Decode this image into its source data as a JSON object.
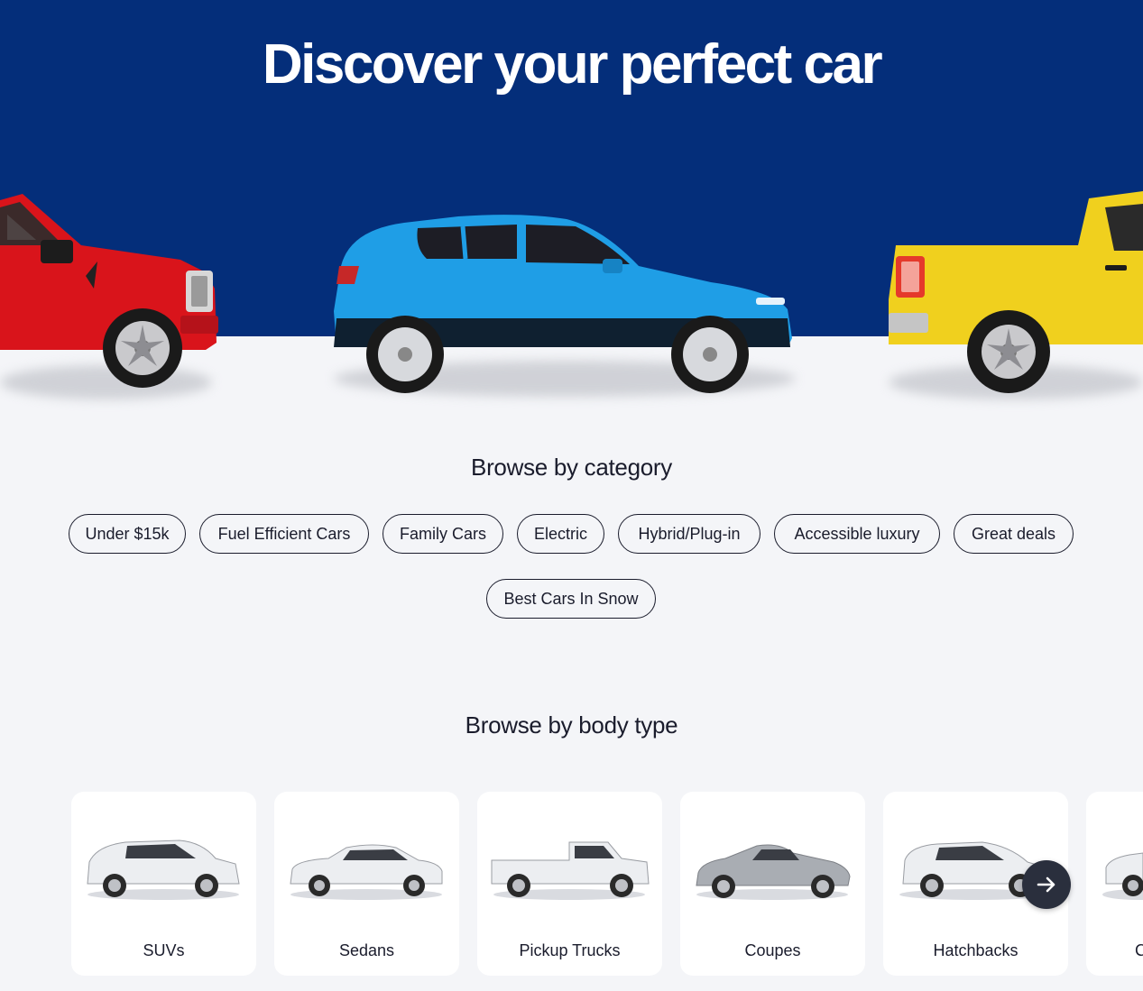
{
  "hero": {
    "title": "Discover your perfect car",
    "background_color": "#042e7a",
    "cars": [
      "red-pickup-truck",
      "blue-suv",
      "yellow-pickup-truck"
    ]
  },
  "category_section": {
    "title": "Browse by category",
    "chips": [
      "Under $15k",
      "Fuel Efficient Cars",
      "Family Cars",
      "Electric",
      "Hybrid/Plug-in",
      "Accessible luxury",
      "Great deals",
      "Best Cars In Snow"
    ]
  },
  "body_type_section": {
    "title": "Browse by body type",
    "cards": [
      {
        "label": "SUVs",
        "icon": "suv-icon"
      },
      {
        "label": "Sedans",
        "icon": "sedan-icon"
      },
      {
        "label": "Pickup Trucks",
        "icon": "pickup-truck-icon"
      },
      {
        "label": "Coupes",
        "icon": "coupe-icon"
      },
      {
        "label": "Hatchbacks",
        "icon": "hatchback-icon"
      },
      {
        "label": "Co",
        "icon": "convertible-icon"
      }
    ],
    "next_icon": "arrow-right-icon"
  }
}
